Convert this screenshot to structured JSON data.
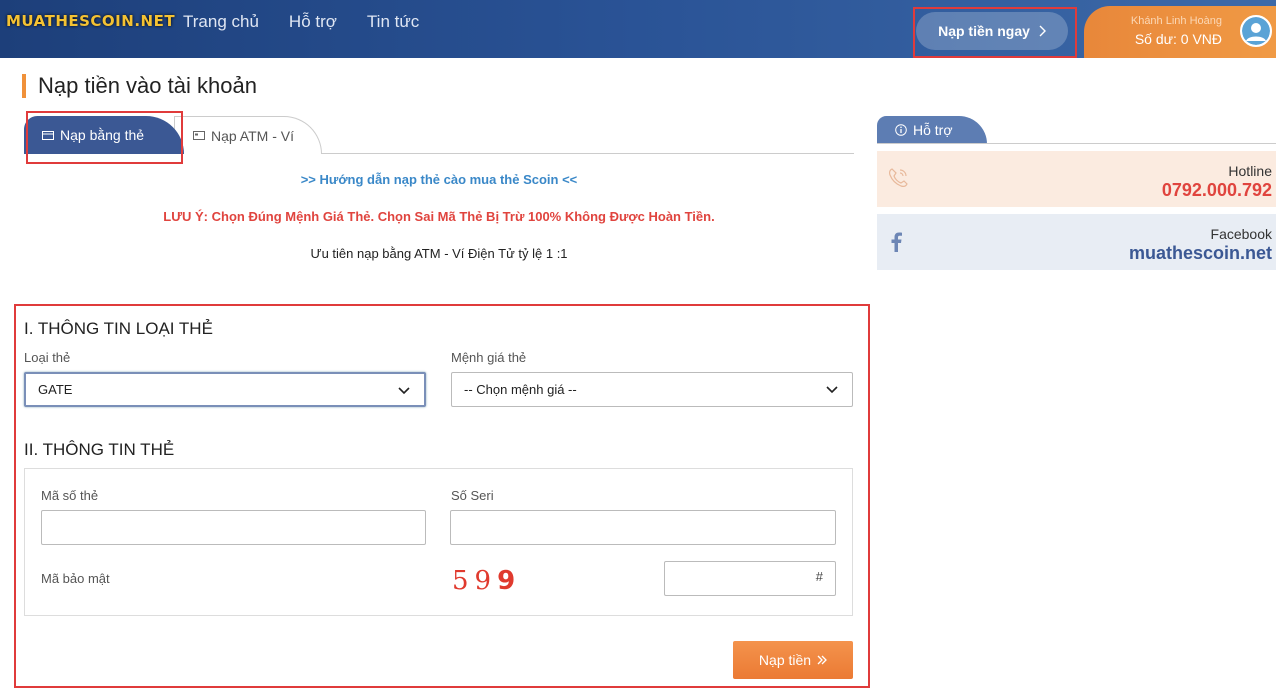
{
  "header": {
    "logo": "MUATHESCOIN.NET",
    "nav": [
      "Trang chủ",
      "Hỗ trợ",
      "Tin tức"
    ],
    "topup_button": "Nạp tiền ngay",
    "user_name": "Khánh Linh Hoàng",
    "balance": "Số dư: 0 VNĐ"
  },
  "page_title": "Nạp tiền vào tài khoản",
  "tabs": [
    {
      "label": "Nạp bằng thẻ",
      "active": true
    },
    {
      "label": "Nạp ATM - Ví",
      "active": false
    }
  ],
  "notices": {
    "guide": ">> Hướng dẫn nạp thẻ cào mua thẻ Scoin <<",
    "warning": "LƯU Ý: Chọn Đúng Mệnh Giá Thẻ. Chọn Sai Mã Thẻ Bị Trừ 100% Không Được Hoàn Tiền.",
    "priority": "Ưu tiên nạp bằng ATM - Ví Điện Tử tỷ lệ 1 :1"
  },
  "form": {
    "section1_title": "I. THÔNG TIN LOẠI THẺ",
    "card_type_label": "Loại thẻ",
    "card_type_value": "GATE",
    "denomination_label": "Mệnh giá thẻ",
    "denomination_value": "-- Chọn mệnh giá --",
    "section2_title": "II. THÔNG TIN THẺ",
    "card_code_label": "Mã số thẻ",
    "serial_label": "Số Seri",
    "security_label": "Mã bảo mật",
    "captcha_digits": "59",
    "captcha_last": "9",
    "security_suffix": "#",
    "submit_label": "Nạp tiền"
  },
  "sidebar": {
    "tab_label": "Hỗ trợ",
    "hotline_label": "Hotline",
    "hotline_value": "0792.000.792",
    "facebook_label": "Facebook",
    "facebook_value": "muathescoin.net"
  },
  "colors": {
    "brand_blue": "#3b5894",
    "accent_orange": "#f0913a",
    "warning_red": "#e0443e",
    "link_blue": "#3a88c8"
  }
}
